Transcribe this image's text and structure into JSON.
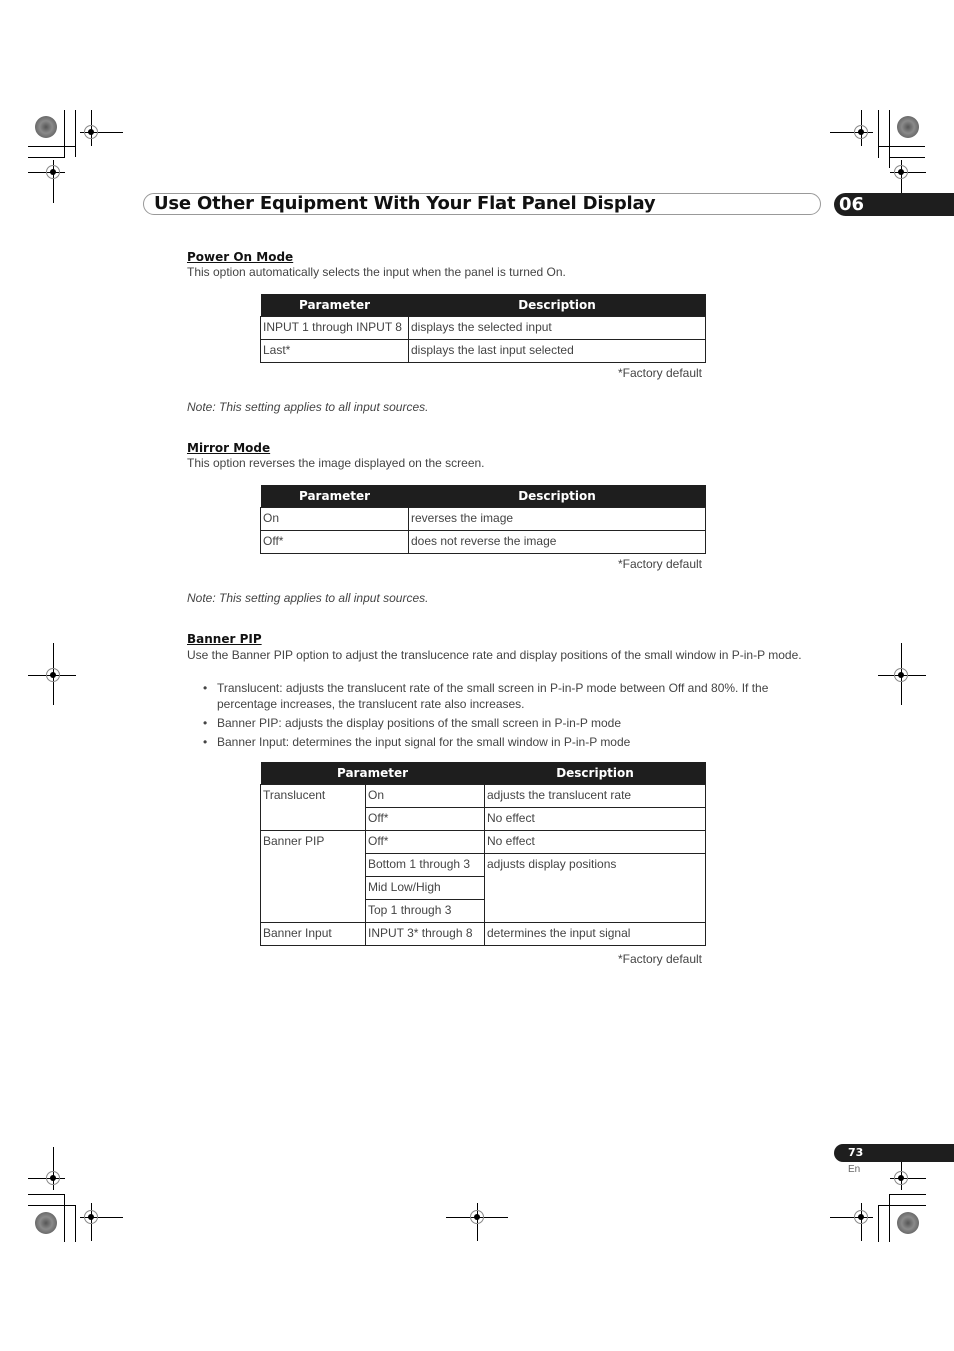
{
  "header": {
    "title": "Use Other Equipment With Your Flat Panel Display",
    "chapter": "06"
  },
  "sections": {
    "power_on": {
      "heading": "Power On Mode",
      "description": "This option automatically selects the input when the panel is turned On.",
      "table": {
        "headers": [
          "Parameter",
          "Description"
        ],
        "rows": [
          [
            "INPUT 1 through INPUT 8",
            "displays the selected input"
          ],
          [
            "Last*",
            "displays the last input selected"
          ]
        ]
      },
      "footnote": "*Factory default",
      "note": "Note: This setting applies to all input sources."
    },
    "mirror": {
      "heading": "Mirror Mode",
      "description": "This option reverses the image displayed on the screen.",
      "table": {
        "headers": [
          "Parameter",
          "Description"
        ],
        "rows": [
          [
            "On",
            "reverses the image"
          ],
          [
            "Off*",
            "does not reverse the image"
          ]
        ]
      },
      "footnote": "*Factory default",
      "note": "Note: This setting applies to all input sources."
    },
    "banner_pip": {
      "heading": "Banner PIP",
      "description": "Use the Banner PIP option to adjust the translucence rate and display positions of the small window in P-in-P mode.",
      "bullets": [
        "Translucent: adjusts the translucent rate of the small screen in P-in-P mode between Off and 80%. If the percentage increases, the translucent rate also increases.",
        "Banner PIP: adjusts the display positions of the small screen in P-in-P mode",
        "Banner Input: determines the input signal for the small window in P-in-P mode"
      ],
      "table": {
        "headers": [
          "Parameter",
          "Description"
        ],
        "groups": {
          "translucent": "Translucent",
          "banner_pip": "Banner PIP",
          "banner_input": "Banner Input"
        },
        "values": {
          "t_on": "On",
          "t_off": "Off*",
          "p_off": "Off*",
          "p_bottom": "Bottom 1 through 3",
          "p_mid": "Mid Low/High",
          "p_top": "Top 1 through 3",
          "i_input": "INPUT 3* through 8"
        },
        "descriptions": {
          "t_on": "adjusts the translucent rate",
          "t_off": "No effect",
          "p_off": "No effect",
          "p_positions": "adjusts display positions",
          "i_input": "determines the input signal"
        }
      },
      "footnote": "*Factory default"
    }
  },
  "footer": {
    "page_number": "73",
    "language": "En"
  }
}
